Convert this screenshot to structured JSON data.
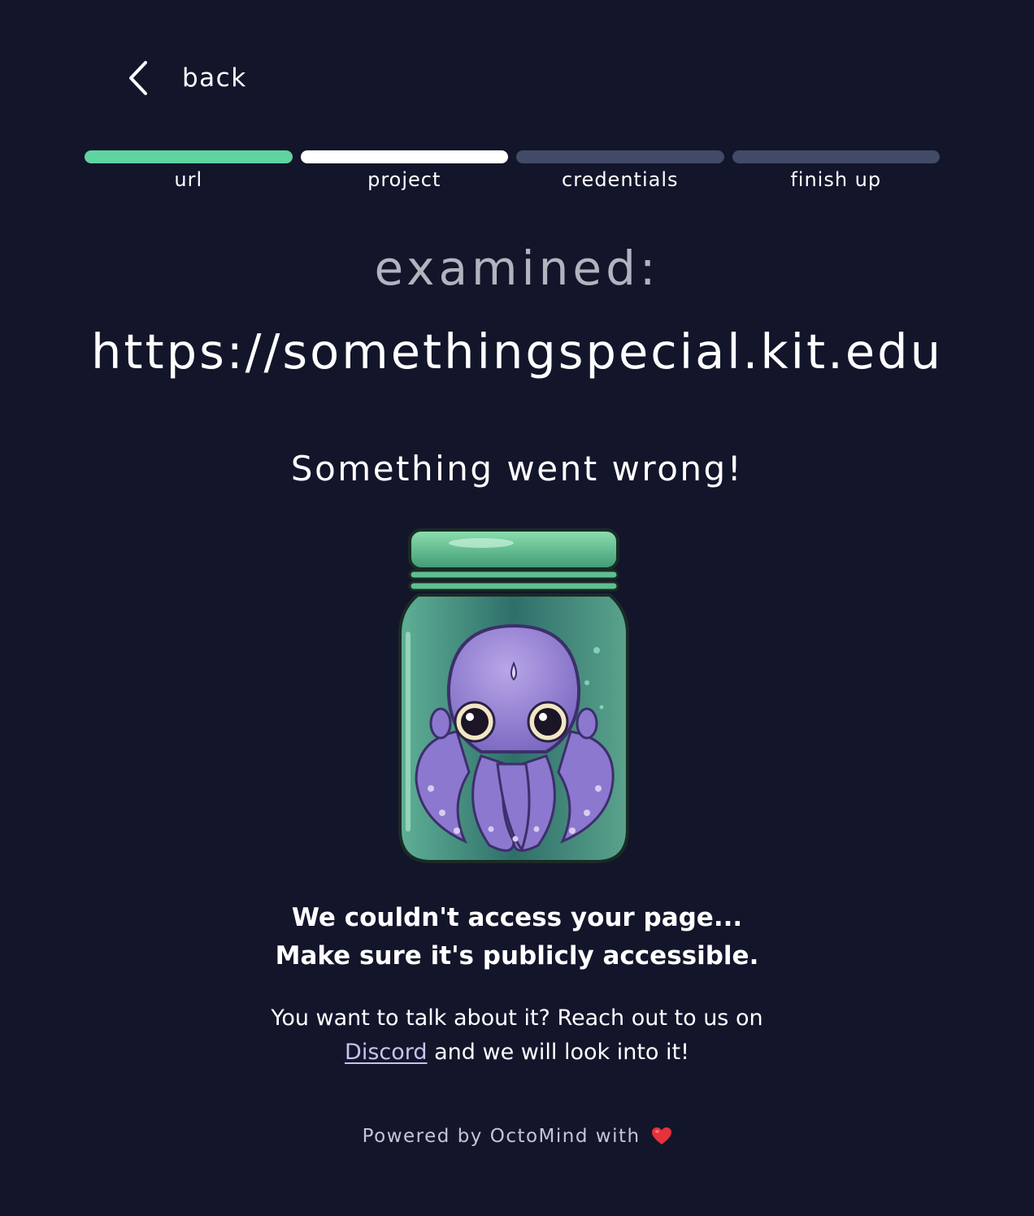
{
  "nav": {
    "back_label": "back",
    "back_icon": "chevron-left-icon"
  },
  "progress": {
    "steps": [
      {
        "label": "url",
        "status": "done"
      },
      {
        "label": "project",
        "status": "current"
      },
      {
        "label": "credentials",
        "status": "pending"
      },
      {
        "label": "finish up",
        "status": "pending"
      }
    ],
    "colors": {
      "done": "#5fd3a0",
      "current": "#ffffff",
      "pending": "#414a66"
    }
  },
  "main": {
    "examined_label": "examined:",
    "url": "https://somethingspecial.kit.edu",
    "heading": "Something went wrong!",
    "illustration": "octopus-in-jar-illustration",
    "error_line1": "We couldn't access your page...",
    "error_line2": "Make sure it's publicly accessible.",
    "help_text1": "You want to talk about it? Reach out to us on",
    "help_link": "Discord",
    "help_text2": "and we will look into it!"
  },
  "footer": {
    "text": "Powered by OctoMind with",
    "icon": "heart-icon"
  },
  "colors": {
    "background": "#13152b",
    "accent": "#5fd3a0",
    "link": "#c8c2ee"
  }
}
